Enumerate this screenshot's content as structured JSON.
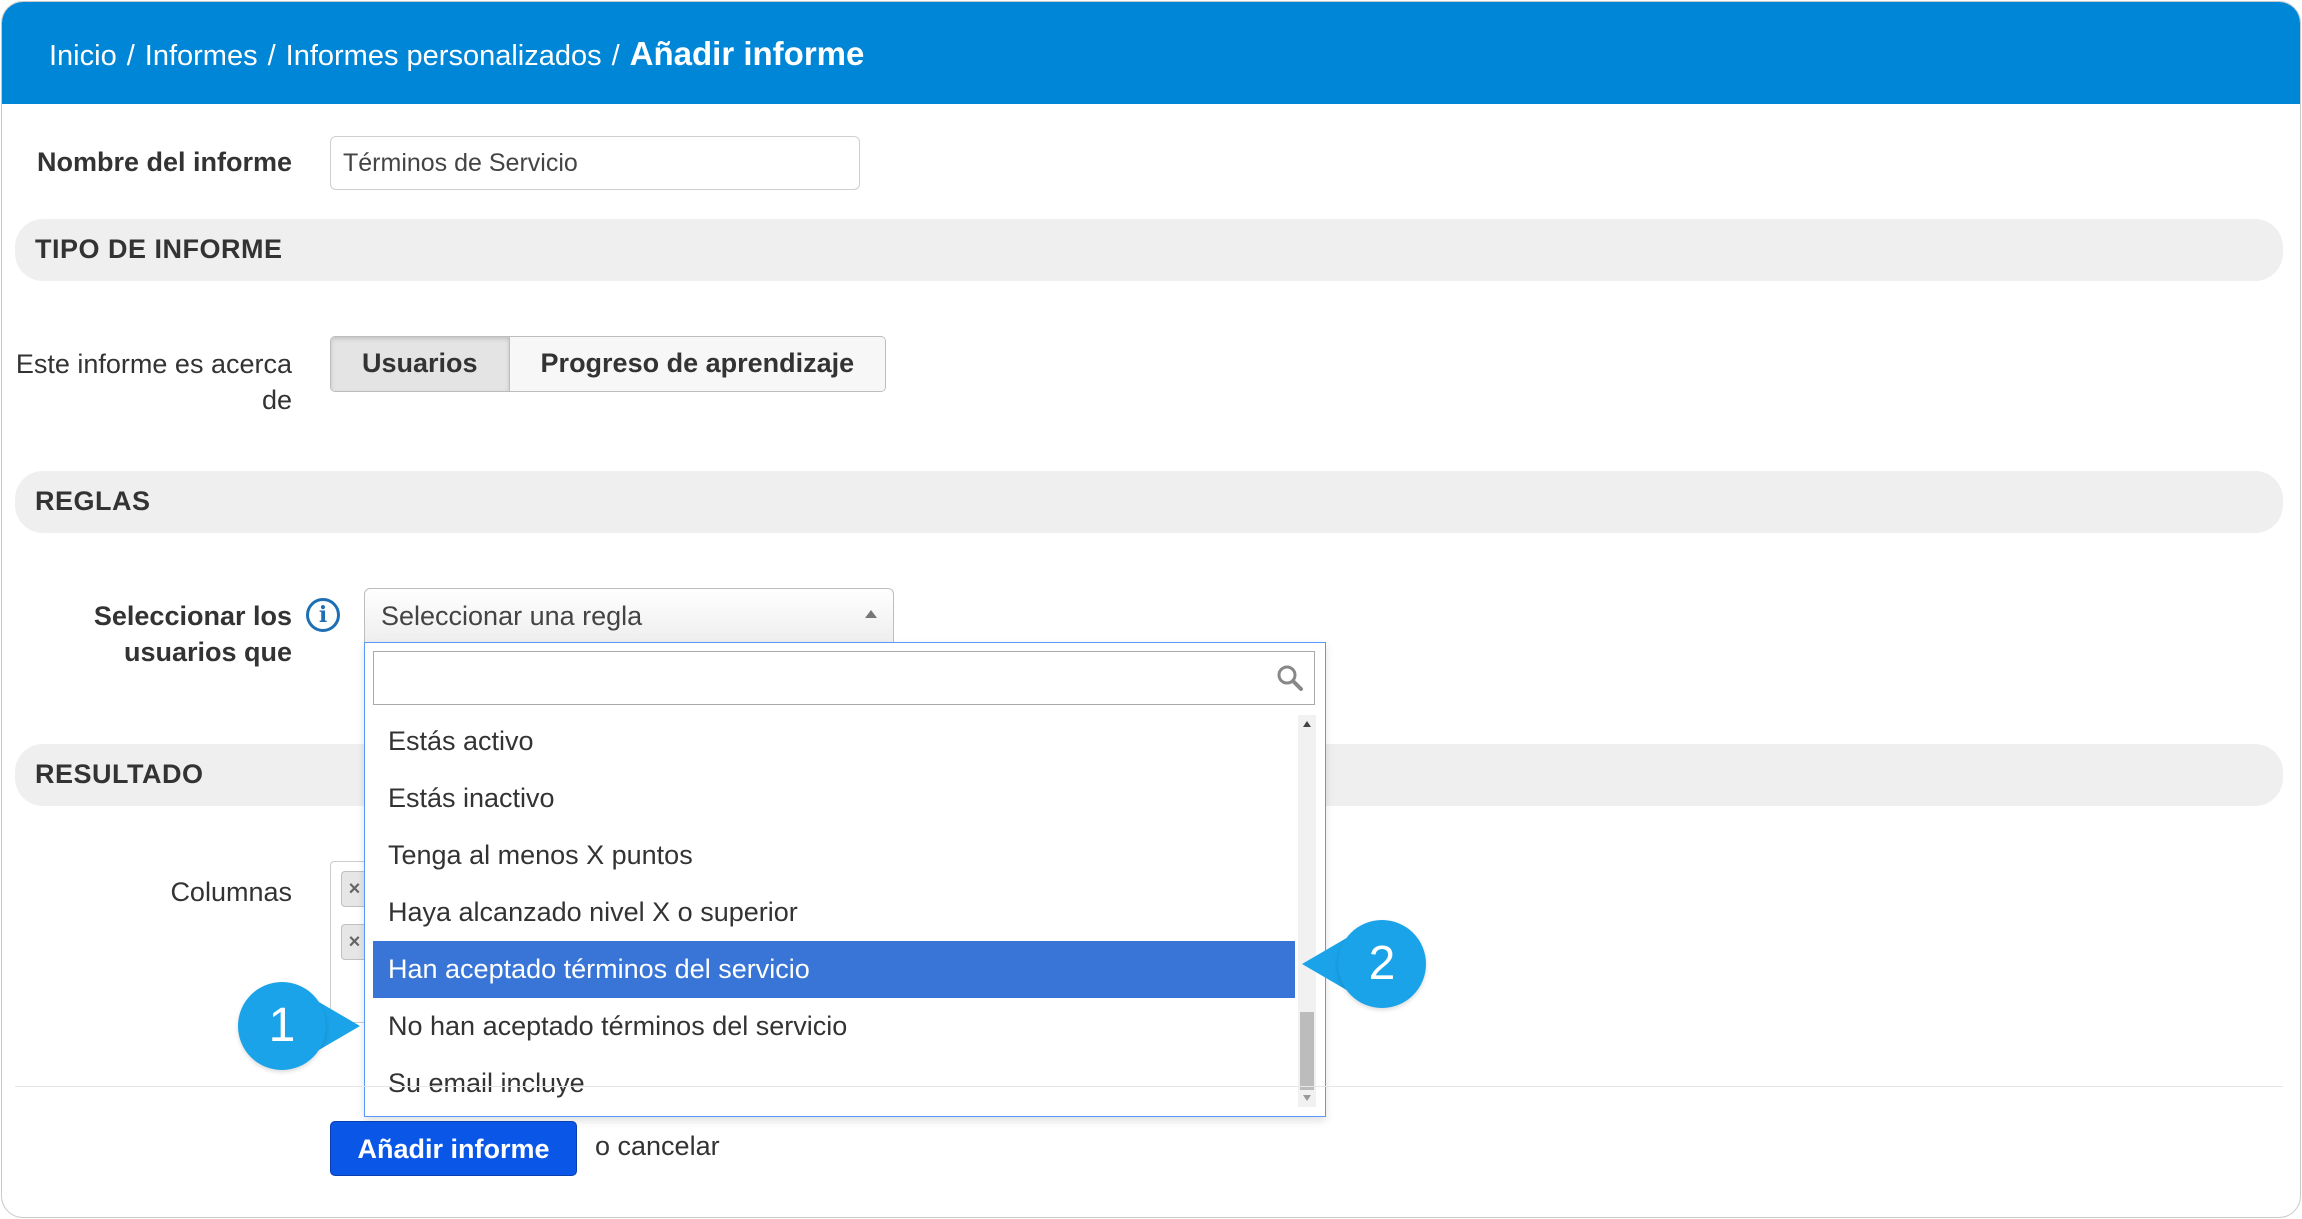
{
  "breadcrumb": {
    "items": [
      "Inicio",
      "Informes",
      "Informes personalizados"
    ],
    "separator": "/",
    "current": "Añadir informe"
  },
  "report_name": {
    "label": "Nombre del informe",
    "value": "Términos de Servicio"
  },
  "sections": {
    "type": "TIPO DE INFORME",
    "rules": "REGLAS",
    "result": "RESULTADO"
  },
  "about": {
    "label_line1": "Este informe es acerca",
    "label_line2": "de",
    "options": [
      "Usuarios",
      "Progreso de aprendizaje"
    ],
    "selected": "Usuarios"
  },
  "rules": {
    "label_line1": "Seleccionar los",
    "label_line2": "usuarios que",
    "select_placeholder": "Seleccionar una regla",
    "search_value": "",
    "options": [
      "Estás activo",
      "Estás inactivo",
      "Tenga al menos X puntos",
      "Haya alcanzado nivel X o superior",
      "Han aceptado términos del servicio",
      "No han aceptado términos del servicio",
      "Su email incluye"
    ],
    "highlighted": "Han aceptado términos del servicio"
  },
  "result": {
    "columns_label": "Columnas"
  },
  "actions": {
    "submit": "Añadir informe",
    "cancel": "o cancelar"
  },
  "callouts": [
    "1",
    "2"
  ],
  "colors": {
    "header": "#0086d6",
    "highlight": "#3875d7",
    "primary_button": "#0a56e6",
    "callout": "#1aa3e8"
  }
}
